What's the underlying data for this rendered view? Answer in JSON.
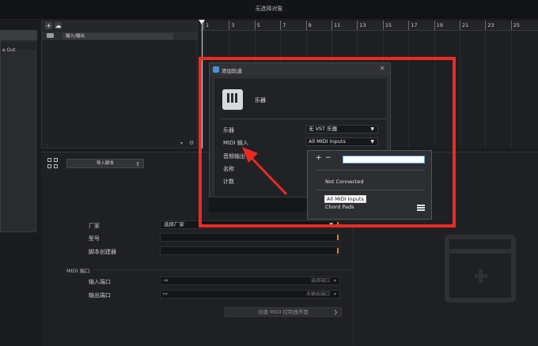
{
  "window": {
    "title": "无选择对象"
  },
  "left_panel": {
    "label": "e Out"
  },
  "tracklist": {
    "add_btn": "+",
    "track_name": "输入/输出"
  },
  "ruler": {
    "ticks": [
      "1",
      "3",
      "5",
      "7",
      "9",
      "11",
      "13",
      "15",
      "17",
      "19",
      "21",
      "23",
      "25"
    ]
  },
  "lower": {
    "script_button": "导入脚本",
    "vendor_label": "厂家",
    "vendor_value": "选择厂家",
    "model_label": "型号",
    "script_author_label": "脚本创建器",
    "midi_section": "MIDI 端口",
    "input_port_label": "输入端口",
    "input_port_value": "选择端口",
    "output_port_label": "输出端口",
    "output_port_value": "未输出端口",
    "create_button": "创建 MIDI 控制器界面"
  },
  "dialog": {
    "title": "添加轨道",
    "heading": "乐器",
    "rows": [
      {
        "label": "乐器",
        "value": "无 VST 乐器"
      },
      {
        "label": "MIDI 输入",
        "value": "All MIDI Inputs"
      },
      {
        "label": "音频输出"
      },
      {
        "label": "名称"
      },
      {
        "label": "计数"
      }
    ]
  },
  "popup": {
    "plus": "+",
    "minus": "−",
    "search_value": "",
    "items": [
      "Not Connected",
      "All MIDI Inputs",
      "Chord Pads"
    ]
  },
  "colors": {
    "annotation": "#ec2a24",
    "accent": "#d98b2b",
    "focus": "#5fa0e6"
  }
}
